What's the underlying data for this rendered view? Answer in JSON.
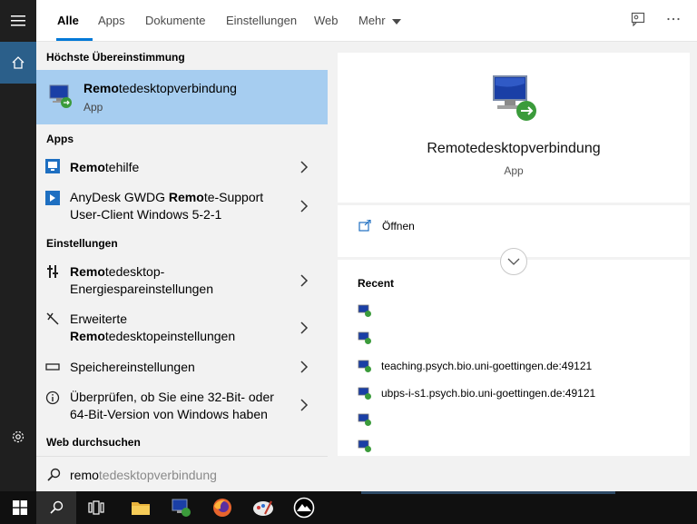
{
  "tabs": [
    {
      "label": "Alle"
    },
    {
      "label": "Apps"
    },
    {
      "label": "Dokumente"
    },
    {
      "label": "Einstellungen"
    },
    {
      "label": "Web"
    },
    {
      "label": "Mehr"
    }
  ],
  "sections": {
    "best": "Höchste Übereinstimmung",
    "apps": "Apps",
    "settings": "Einstellungen",
    "web": "Web durchsuchen"
  },
  "best_match": {
    "title_bold": "Remo",
    "title_rest": "tedesktopverbindung",
    "subtitle": "App"
  },
  "apps": [
    {
      "bold": "Remo",
      "rest": "tehilfe"
    },
    {
      "pre": "AnyDesk GWDG ",
      "bold": "Remo",
      "rest": "te-Support",
      "line2": "User-Client Windows 5-2-1"
    }
  ],
  "settings": [
    {
      "bold": "Remo",
      "rest": "tedesktop-",
      "line2": "Energiespareinstellungen"
    },
    {
      "line1": "Erweiterte",
      "bold": "Remo",
      "rest": "tedesktopeinstellungen"
    },
    {
      "line1": "Speichereinstellungen"
    },
    {
      "line1": "Überprüfen, ob Sie eine 32-Bit- oder",
      "line2": "64-Bit-Version von Windows haben"
    }
  ],
  "search": {
    "typed": "remo",
    "suggestion": "tedesktopverbindung"
  },
  "detail": {
    "title": "Remotedesktopverbindung",
    "subtitle": "App",
    "open_label": "Öffnen",
    "recent_title": "Recent",
    "recent": [
      "",
      "",
      "teaching.psych.bio.uni-goettingen.de:49121",
      "ubps-i-s1.psych.bio.uni-goettingen.de:49121",
      "",
      ""
    ]
  },
  "colors": {
    "accent": "#0078d7",
    "selection": "#a6cdf0",
    "rail": "#1f1f1f",
    "home": "#2b5f8a",
    "taskbar": "#101010"
  }
}
